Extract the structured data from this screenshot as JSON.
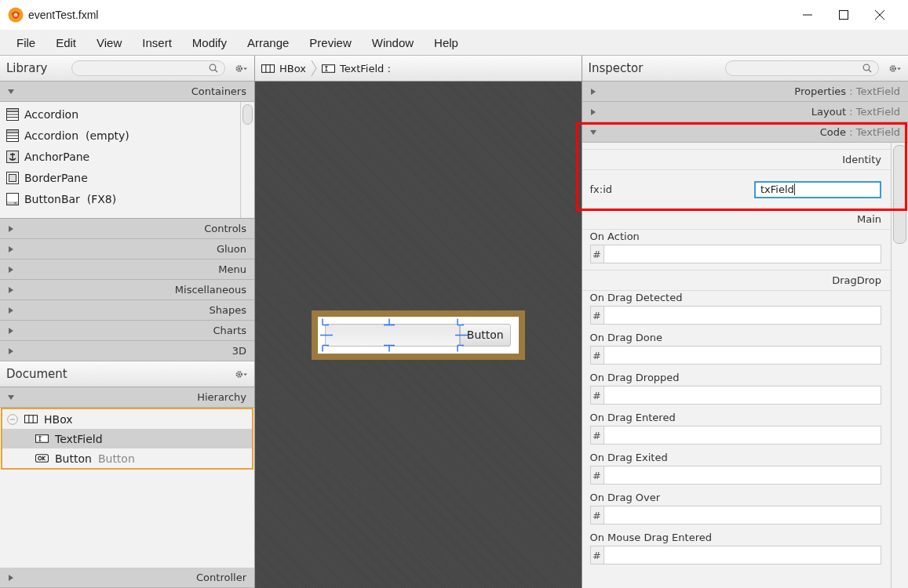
{
  "window": {
    "title": "eventTest.fxml"
  },
  "menu": [
    "File",
    "Edit",
    "View",
    "Insert",
    "Modify",
    "Arrange",
    "Preview",
    "Window",
    "Help"
  ],
  "library": {
    "title": "Library",
    "sections": [
      {
        "label": "Containers",
        "expanded": true,
        "items": [
          {
            "label": "Accordion",
            "kind": "accordion"
          },
          {
            "label": "Accordion  (empty)",
            "kind": "accordion"
          },
          {
            "label": "AnchorPane",
            "kind": "anchor"
          },
          {
            "label": "BorderPane",
            "kind": "border"
          },
          {
            "label": "ButtonBar  (FX8)",
            "kind": "buttonbar"
          }
        ]
      },
      {
        "label": "Controls",
        "expanded": false
      },
      {
        "label": "Gluon",
        "expanded": false
      },
      {
        "label": "Menu",
        "expanded": false
      },
      {
        "label": "Miscellaneous",
        "expanded": false
      },
      {
        "label": "Shapes",
        "expanded": false
      },
      {
        "label": "Charts",
        "expanded": false
      },
      {
        "label": "3D",
        "expanded": false
      }
    ]
  },
  "document": {
    "title": "Document",
    "hierarchy": {
      "label": "Hierarchy",
      "expanded": true,
      "tree": [
        {
          "label": "HBox",
          "kind": "hbox",
          "expanded": true,
          "selected": false,
          "children": [
            {
              "label": "TextField",
              "kind": "textfield",
              "selected": true
            },
            {
              "label": "Button",
              "secondary": "Button",
              "kind": "button",
              "selected": false
            }
          ]
        }
      ]
    },
    "controller": {
      "label": "Controller",
      "expanded": false
    }
  },
  "breadcrumb": [
    {
      "label": "HBox",
      "kind": "hbox"
    },
    {
      "label": "TextField :",
      "kind": "textfield"
    }
  ],
  "canvas": {
    "button_label": "Button",
    "selected": true
  },
  "inspector": {
    "title": "Inspector",
    "sections": [
      {
        "name": "Properties",
        "target": ": TextField",
        "expanded": false
      },
      {
        "name": "Layout",
        "target": ": TextField",
        "expanded": false
      },
      {
        "name": "Code",
        "target": ": TextField",
        "expanded": true,
        "highlighted": true
      }
    ],
    "groups": [
      {
        "heading": "Identity",
        "fields": [
          {
            "kind": "inline",
            "label": "fx:id",
            "value": "txField",
            "focused": true
          }
        ]
      },
      {
        "heading": "Main",
        "fields": [
          {
            "kind": "handler",
            "label": "On Action",
            "prefix": "#"
          }
        ]
      },
      {
        "heading": "DragDrop",
        "fields": [
          {
            "kind": "handler",
            "label": "On Drag Detected",
            "prefix": "#"
          },
          {
            "kind": "handler",
            "label": "On Drag Done",
            "prefix": "#"
          },
          {
            "kind": "handler",
            "label": "On Drag Dropped",
            "prefix": "#"
          },
          {
            "kind": "handler",
            "label": "On Drag Entered",
            "prefix": "#"
          },
          {
            "kind": "handler",
            "label": "On Drag Exited",
            "prefix": "#"
          },
          {
            "kind": "handler",
            "label": "On Drag Over",
            "prefix": "#"
          },
          {
            "kind": "handler",
            "label": "On Mouse Drag Entered",
            "prefix": "#"
          }
        ]
      }
    ]
  }
}
